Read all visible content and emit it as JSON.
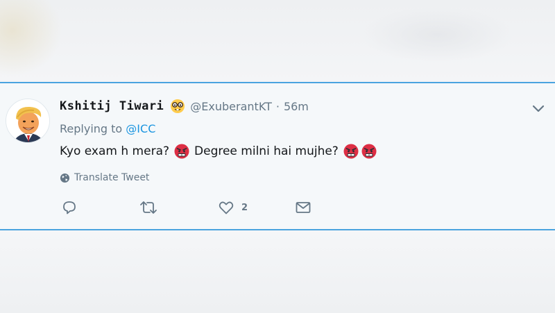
{
  "tweet": {
    "display_name": "Kshitij Tiwari",
    "handle": "@ExuberantKT",
    "separator": "·",
    "time": "56m",
    "replying_prefix": "Replying to",
    "replying_to": "@ICC",
    "text_part1": "Kyo exam h mera?",
    "text_part2": "Degree milni hai mujhe?",
    "translate_label": "Translate Tweet",
    "like_count": "2",
    "icons": {
      "name_emoji": "nerd-face-icon",
      "inline_emoji": "angry-face-icon",
      "menu": "chevron-down-icon",
      "reply": "reply-icon",
      "retweet": "retweet-icon",
      "like": "heart-icon",
      "dm": "envelope-icon",
      "translate": "globe-icon"
    }
  },
  "colors": {
    "accent": "#1b95e0",
    "border": "#4aa3df",
    "muted": "#657786",
    "angry_emoji": "#dd2e44"
  }
}
